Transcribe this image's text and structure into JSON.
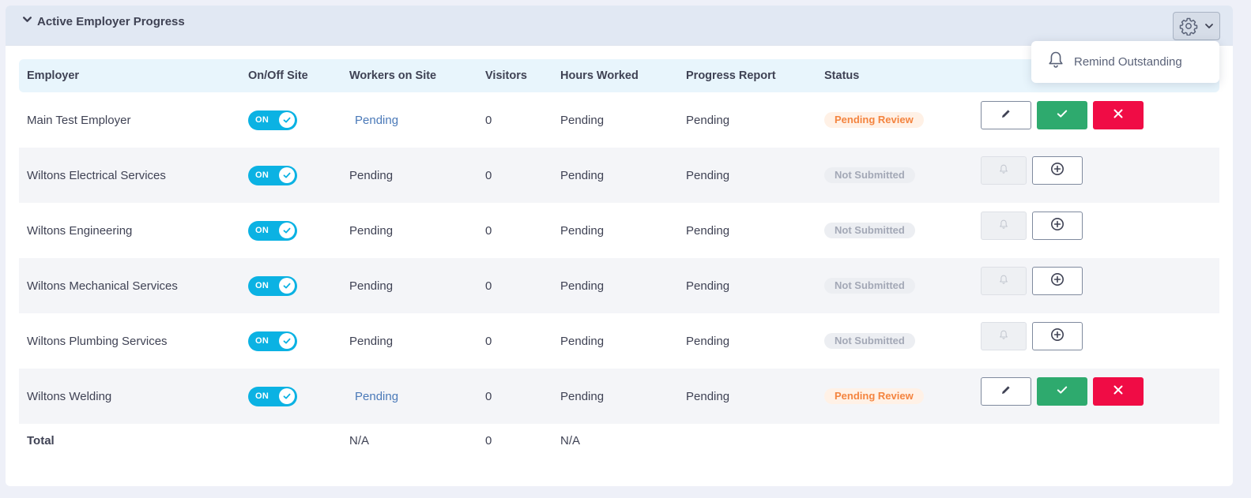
{
  "panel": {
    "title": "Active Employer Progress",
    "menu": {
      "remind_label": "Remind Outstanding"
    }
  },
  "table": {
    "columns": [
      "Employer",
      "On/Off Site",
      "Workers on Site",
      "Visitors",
      "Hours Worked",
      "Progress Report",
      "Status"
    ],
    "rows": [
      {
        "employer": "Main Test Employer",
        "site": "ON",
        "workers": "Pending",
        "visitors": "0",
        "hours": "Pending",
        "report": "Pending",
        "status": "Pending Review"
      },
      {
        "employer": "Wiltons Electrical Services",
        "site": "ON",
        "workers": "Pending",
        "visitors": "0",
        "hours": "Pending",
        "report": "Pending",
        "status": "Not Submitted"
      },
      {
        "employer": "Wiltons Engineering",
        "site": "ON",
        "workers": "Pending",
        "visitors": "0",
        "hours": "Pending",
        "report": "Pending",
        "status": "Not Submitted"
      },
      {
        "employer": "Wiltons Mechanical Services",
        "site": "ON",
        "workers": "Pending",
        "visitors": "0",
        "hours": "Pending",
        "report": "Pending",
        "status": "Not Submitted"
      },
      {
        "employer": "Wiltons Plumbing Services",
        "site": "ON",
        "workers": "Pending",
        "visitors": "0",
        "hours": "Pending",
        "report": "Pending",
        "status": "Not Submitted"
      },
      {
        "employer": "Wiltons Welding",
        "site": "ON",
        "workers": "Pending",
        "visitors": "0",
        "hours": "Pending",
        "report": "Pending",
        "status": "Pending Review"
      }
    ],
    "total": {
      "label": "Total",
      "workers": "N/A",
      "visitors": "0",
      "hours": "N/A"
    }
  },
  "colors": {
    "toggle_on": "#0bb2e3",
    "approve": "#2eaa6e",
    "reject": "#f00c45",
    "pending_review": "#f4843f",
    "not_submitted": "#a3a8b6",
    "link": "#4a79b8"
  },
  "icons": {
    "collapse": "chevron-down-icon",
    "settings": "gear-icon",
    "menu_caret": "chevron-down-icon",
    "remind": "bell-icon",
    "edit": "pencil-icon",
    "approve": "check-icon",
    "reject": "close-icon",
    "add": "plus-circle-icon"
  }
}
